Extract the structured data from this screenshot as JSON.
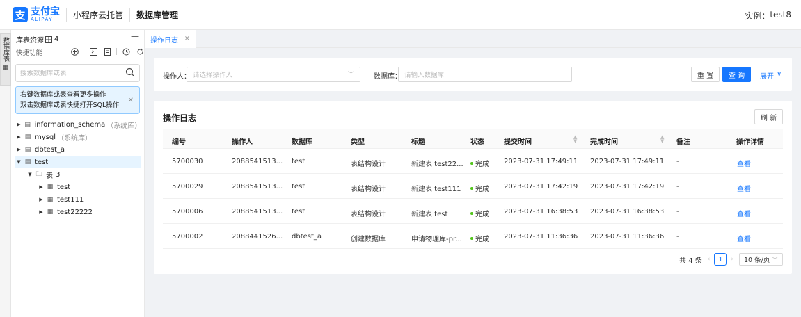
{
  "header": {
    "logo_cn": "支付宝",
    "logo_en": "ALIPAY",
    "app_name": "小程序云托管",
    "section": "数据库管理",
    "instance_label": "实例：",
    "instance_value": "test8"
  },
  "vstrip": {
    "label": "数据库表"
  },
  "sidebar": {
    "title": "库表资源",
    "count": "4",
    "quick_label": "快捷功能",
    "search_placeholder": "搜索数据库或表",
    "tip_line1": "右键数据库或表查看更多操作",
    "tip_line2": "双击数据库或表快捷打开SQL操作",
    "tree": [
      {
        "label": "information_schema",
        "note": "（系统库）"
      },
      {
        "label": "mysql",
        "note": "（系统库）"
      },
      {
        "label": "dbtest_a",
        "note": ""
      },
      {
        "label": "test",
        "note": ""
      }
    ],
    "tables_group": {
      "label": "表",
      "count": "3"
    },
    "tables": [
      "test",
      "test111",
      "test22222"
    ]
  },
  "tabs": [
    {
      "label": "操作日志"
    }
  ],
  "filter": {
    "operator_label": "操作人：",
    "operator_placeholder": "请选择操作人",
    "db_label": "数据库：",
    "db_placeholder": "请输入数据库",
    "reset_label": "重 置",
    "query_label": "查 询",
    "expand_label": "展开"
  },
  "panel": {
    "title": "操作日志",
    "refresh_label": "刷 新",
    "columns": [
      "编号",
      "操作人",
      "数据库",
      "类型",
      "标题",
      "状态",
      "提交时间",
      "完成时间",
      "备注",
      "操作详情"
    ],
    "rows": [
      {
        "id": "5700030",
        "operator": "2088541513...",
        "db": "test",
        "type": "表结构设计",
        "title": "新建表 test22...",
        "status": "完成",
        "submit": "2023-07-31 17:49:11",
        "finish": "2023-07-31 17:49:11",
        "note": "-",
        "action": "查看"
      },
      {
        "id": "5700029",
        "operator": "2088541513...",
        "db": "test",
        "type": "表结构设计",
        "title": "新建表 test111",
        "status": "完成",
        "submit": "2023-07-31 17:42:19",
        "finish": "2023-07-31 17:42:19",
        "note": "-",
        "action": "查看"
      },
      {
        "id": "5700006",
        "operator": "2088541513...",
        "db": "test",
        "type": "表结构设计",
        "title": "新建表 test",
        "status": "完成",
        "submit": "2023-07-31 16:38:53",
        "finish": "2023-07-31 16:38:53",
        "note": "-",
        "action": "查看"
      },
      {
        "id": "5700002",
        "operator": "2088441526...",
        "db": "dbtest_a",
        "type": "创建数据库",
        "title": "申请物理库-pr...",
        "status": "完成",
        "submit": "2023-07-31 11:36:36",
        "finish": "2023-07-31 11:36:36",
        "note": "-",
        "action": "查看"
      }
    ],
    "pagination": {
      "total": "共 4 条",
      "page": "1",
      "page_size": "10 条/页"
    }
  },
  "colors": {
    "primary": "#1677ff",
    "success": "#52c41a"
  }
}
